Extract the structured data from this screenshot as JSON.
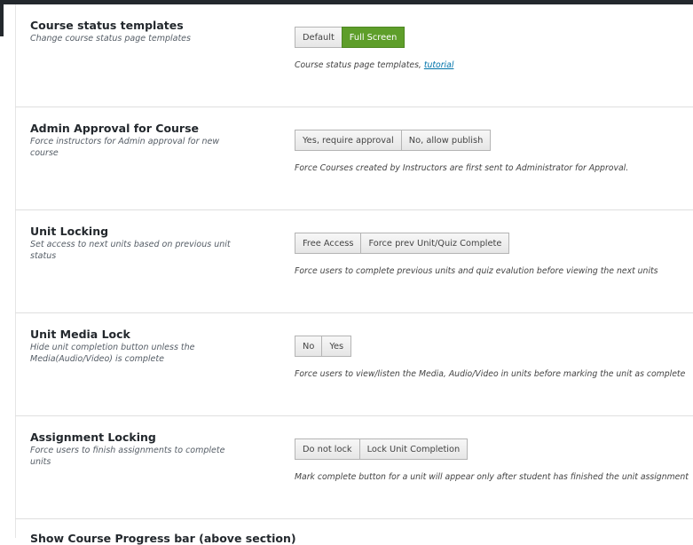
{
  "settings": [
    {
      "title": "Course status templates",
      "description": "Change course status page templates",
      "options": [
        "Default",
        "Full Screen"
      ],
      "selected": "Full Screen",
      "help": "Course status page templates, ",
      "help_link": "tutorial"
    },
    {
      "title": "Admin Approval for Course",
      "description": "Force instructors for Admin approval for new course",
      "options": [
        "Yes, require approval",
        "No, allow publish"
      ],
      "selected": "",
      "help": "Force Courses created by Instructors are first sent to Administrator for Approval.",
      "help_link": ""
    },
    {
      "title": "Unit Locking",
      "description": "Set access to next units based on previous unit status",
      "options": [
        "Free Access",
        "Force prev Unit/Quiz Complete"
      ],
      "selected": "",
      "help": "Force users to complete previous units and quiz evalution before viewing the next units",
      "help_link": ""
    },
    {
      "title": "Unit Media Lock",
      "description": "Hide unit completion button unless the Media(Audio/Video) is complete",
      "options": [
        "No",
        "Yes"
      ],
      "selected": "",
      "help": "Force users to view/listen the Media, Audio/Video in units before marking the unit as complete",
      "help_link": ""
    },
    {
      "title": "Assignment Locking",
      "description": "Force users to finish assignments to complete units",
      "options": [
        "Do not lock",
        "Lock Unit Completion"
      ],
      "selected": "",
      "help": "Mark complete button for a unit will appear only after student has finished the unit assignment",
      "help_link": ""
    }
  ],
  "next_setting_partial": "Show Course Progress bar (above section)",
  "colors": {
    "active_button": "#5e9e2a",
    "link": "#0073aa",
    "topbar": "#23282d"
  }
}
